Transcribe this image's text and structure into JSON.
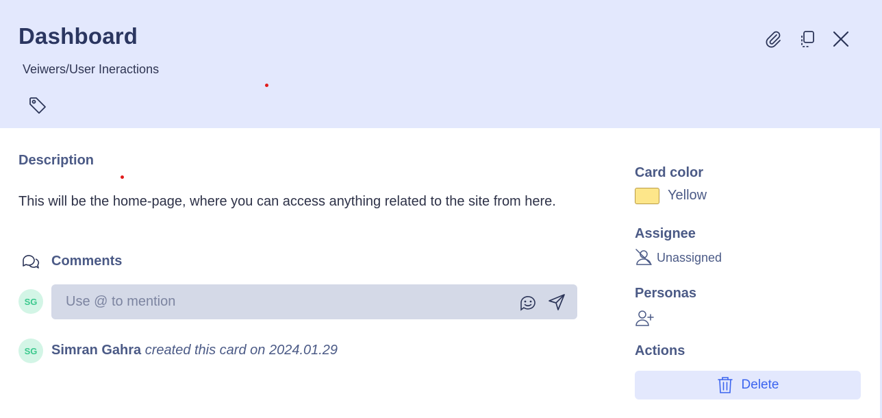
{
  "card": {
    "title": "Dashboard",
    "subtitle": "Veiwers/User Ineractions"
  },
  "header_icons": {
    "tag": "tag-icon",
    "attach": "paperclip-icon",
    "copy": "copy-icon",
    "close": "close-icon"
  },
  "description": {
    "label": "Description",
    "text": "This will be the home-page, where you can access anything related to the site from here."
  },
  "comments": {
    "label": "Comments",
    "avatar_initials": "SG",
    "input_value": "",
    "input_placeholder": "Use @ to mention"
  },
  "activity": {
    "avatar_initials": "SG",
    "user_name": "Simran Gahra",
    "action_text": "created this card on 2024.01.29"
  },
  "sidebar": {
    "card_color_label": "Card color",
    "card_color_name": "Yellow",
    "card_color_hex": "#fde68a",
    "assignee_label": "Assignee",
    "assignee_value": "Unassigned",
    "personas_label": "Personas",
    "actions_label": "Actions",
    "delete_label": "Delete"
  },
  "colors": {
    "header_bg": "#e3e8fd",
    "accent": "#3b64ef",
    "avatar_bg": "#d3f5e6",
    "avatar_text": "#3cc98e"
  }
}
